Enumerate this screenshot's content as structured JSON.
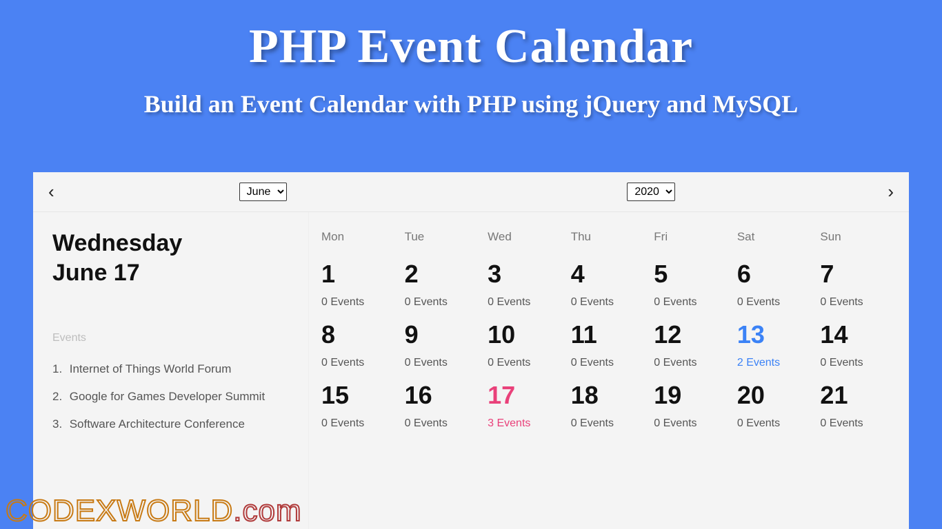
{
  "hero": {
    "title": "PHP Event Calendar",
    "subtitle": "Build an Event Calendar with PHP using jQuery and MySQL"
  },
  "watermark": {
    "main": "CODEXWORLD",
    "suffix": ".com"
  },
  "calendar": {
    "month_select": "June",
    "year_select": "2020",
    "dow": [
      "Mon",
      "Tue",
      "Wed",
      "Thu",
      "Fri",
      "Sat",
      "Sun"
    ],
    "weeks": [
      [
        {
          "n": "1",
          "e": "0 Events"
        },
        {
          "n": "2",
          "e": "0 Events"
        },
        {
          "n": "3",
          "e": "0 Events"
        },
        {
          "n": "4",
          "e": "0 Events"
        },
        {
          "n": "5",
          "e": "0 Events"
        },
        {
          "n": "6",
          "e": "0 Events"
        },
        {
          "n": "7",
          "e": "0 Events"
        }
      ],
      [
        {
          "n": "8",
          "e": "0 Events"
        },
        {
          "n": "9",
          "e": "0 Events"
        },
        {
          "n": "10",
          "e": "0 Events"
        },
        {
          "n": "11",
          "e": "0 Events"
        },
        {
          "n": "12",
          "e": "0 Events"
        },
        {
          "n": "13",
          "e": "2 Events",
          "hl": "blue"
        },
        {
          "n": "14",
          "e": "0 Events"
        }
      ],
      [
        {
          "n": "15",
          "e": "0 Events"
        },
        {
          "n": "16",
          "e": "0 Events"
        },
        {
          "n": "17",
          "e": "3 Events",
          "hl": "pink"
        },
        {
          "n": "18",
          "e": "0 Events"
        },
        {
          "n": "19",
          "e": "0 Events"
        },
        {
          "n": "20",
          "e": "0 Events"
        },
        {
          "n": "21",
          "e": "0 Events"
        }
      ]
    ]
  },
  "sidebar": {
    "weekday": "Wednesday",
    "date": "June 17",
    "events_label": "Events",
    "items": [
      "Internet of Things World Forum",
      "Google for Games Developer Summit",
      "Software Architecture Conference"
    ]
  }
}
